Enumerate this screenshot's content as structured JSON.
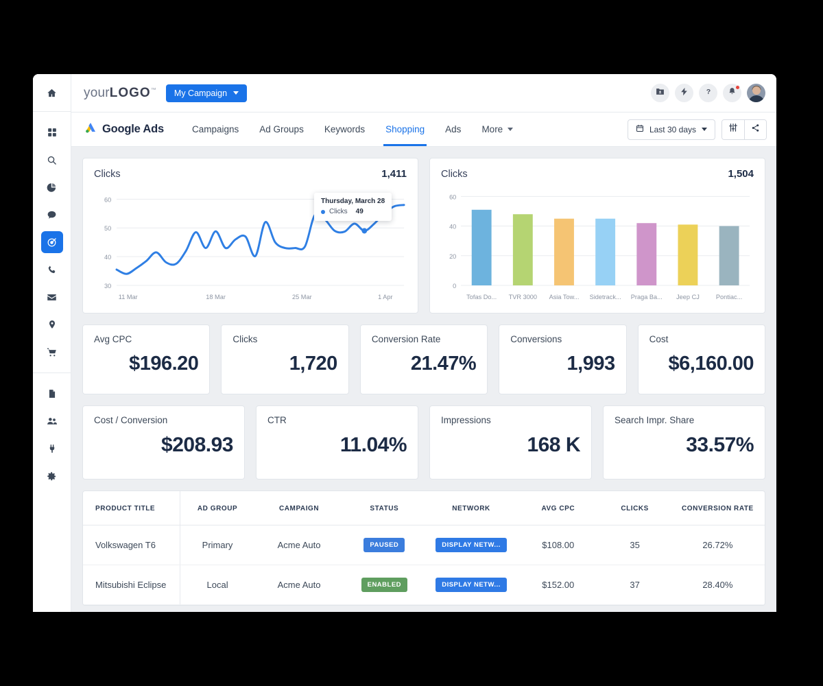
{
  "brand": {
    "logo_prefix": "your",
    "logo_bold": "LOGO",
    "logo_tm": "™",
    "campaign_button": "My Campaign"
  },
  "header_icons": [
    {
      "name": "folder-download-icon"
    },
    {
      "name": "lightning-bolt-icon"
    },
    {
      "name": "help-question-icon"
    },
    {
      "name": "notifications-bell-icon"
    }
  ],
  "nav": {
    "product": "Google Ads",
    "tabs": [
      {
        "label": "Campaigns",
        "active": false
      },
      {
        "label": "Ad Groups",
        "active": false
      },
      {
        "label": "Keywords",
        "active": false
      },
      {
        "label": "Shopping",
        "active": true
      },
      {
        "label": "Ads",
        "active": false
      },
      {
        "label": "More",
        "active": false,
        "caret": true
      }
    ],
    "date_range": "Last 30 days",
    "columns_icon": "columns-icon",
    "share_icon": "share-icon"
  },
  "sidebar": {
    "items": [
      {
        "name": "sidebar-item-home",
        "icon": "home-icon"
      },
      {
        "name": "sidebar-item-dashboard",
        "icon": "grid-apps-icon"
      },
      {
        "name": "sidebar-item-search",
        "icon": "search-icon"
      },
      {
        "name": "sidebar-item-analytics",
        "icon": "pie-chart-icon"
      },
      {
        "name": "sidebar-item-messages",
        "icon": "chat-bubble-icon"
      },
      {
        "name": "sidebar-item-campaigns",
        "icon": "target-bullseye-icon",
        "active": true
      },
      {
        "name": "sidebar-item-calls",
        "icon": "phone-icon"
      },
      {
        "name": "sidebar-item-mail",
        "icon": "envelope-icon"
      },
      {
        "name": "sidebar-item-locations",
        "icon": "map-pin-icon"
      },
      {
        "name": "sidebar-item-shop",
        "icon": "shopping-cart-icon"
      },
      {
        "name": "sidebar-item-documents",
        "icon": "document-icon"
      },
      {
        "name": "sidebar-item-users",
        "icon": "users-icon"
      },
      {
        "name": "sidebar-item-integrations",
        "icon": "plug-icon"
      },
      {
        "name": "sidebar-item-settings",
        "icon": "gear-icon"
      }
    ]
  },
  "chart_data": [
    {
      "type": "line",
      "title": "Clicks",
      "total": "1,411",
      "xlabel": "",
      "ylabel": "",
      "ylim": [
        30,
        62
      ],
      "yticks": [
        30,
        40,
        50,
        60
      ],
      "xtick_labels": [
        "11 Mar",
        "18 Mar",
        "25 Mar",
        "1 Apr"
      ],
      "grid": true,
      "legend": "none",
      "line_color": "#2f7fe4",
      "values": [
        35.5,
        34.0,
        36.0,
        38.5,
        41.5,
        38.0,
        37.5,
        42.0,
        48.5,
        43.0,
        48.8,
        43.0,
        46.0,
        47.0,
        40.2,
        52.0,
        45.0,
        43.0,
        43.0,
        43.5,
        54.5,
        53.0,
        49.0,
        48.7,
        51.5,
        49.0,
        51.5,
        55.0,
        57.5,
        58.0
      ],
      "tooltip": {
        "title": "Thursday, March 28",
        "series_label": "Clicks",
        "series_value": "49",
        "point_index": 25
      }
    },
    {
      "type": "bar",
      "title": "Clicks",
      "total": "1,504",
      "xlabel": "",
      "ylabel": "",
      "ylim": [
        0,
        62
      ],
      "yticks": [
        0,
        20,
        40,
        60
      ],
      "grid": true,
      "legend": "none",
      "categories": [
        "Tofas Do...",
        "TVR 3000",
        "Asia Tow...",
        "Sidetrack...",
        "Praga Ba...",
        "Jeep CJ",
        "Pontiac..."
      ],
      "values": [
        51,
        48,
        45,
        45,
        42,
        41,
        40
      ],
      "colors": [
        "#6db3de",
        "#b5d472",
        "#f5c473",
        "#97d1f5",
        "#cf95ca",
        "#ecd158",
        "#9ab4bf"
      ]
    }
  ],
  "kpis_row1": [
    {
      "label": "Avg CPC",
      "value": "$196.20"
    },
    {
      "label": "Clicks",
      "value": "1,720"
    },
    {
      "label": "Conversion Rate",
      "value": "21.47%"
    },
    {
      "label": "Conversions",
      "value": "1,993"
    },
    {
      "label": "Cost",
      "value": "$6,160.00"
    }
  ],
  "kpis_row2": [
    {
      "label": "Cost / Conversion",
      "value": "$208.93"
    },
    {
      "label": "CTR",
      "value": "11.04%"
    },
    {
      "label": "Impressions",
      "value": "168 K"
    },
    {
      "label": "Search Impr. Share",
      "value": "33.57%"
    }
  ],
  "table": {
    "columns": [
      "PRODUCT TITLE",
      "AD GROUP",
      "CAMPAIGN",
      "STATUS",
      "NETWORK",
      "AVG CPC",
      "CLICKS",
      "CONVERSION RATE"
    ],
    "rows": [
      {
        "product_title": "Volkswagen T6",
        "ad_group": "Primary",
        "campaign": "Acme Auto",
        "status": "PAUSED",
        "status_kind": "paused",
        "network": "DISPLAY NETW...",
        "avg_cpc": "$108.00",
        "clicks": "35",
        "conversion_rate": "26.72%"
      },
      {
        "product_title": "Mitsubishi Eclipse",
        "ad_group": "Local",
        "campaign": "Acme Auto",
        "status": "ENABLED",
        "status_kind": "enabled",
        "network": "DISPLAY NETW...",
        "avg_cpc": "$152.00",
        "clicks": "37",
        "conversion_rate": "28.40%"
      }
    ]
  },
  "colors": {
    "accent": "#1a73e8",
    "page_bg": "#edeff2",
    "text_dark": "#1c2b45",
    "status_paused": "#3b7ddd",
    "status_enabled": "#5f9e5f",
    "network_chip": "#2f7ae5"
  }
}
